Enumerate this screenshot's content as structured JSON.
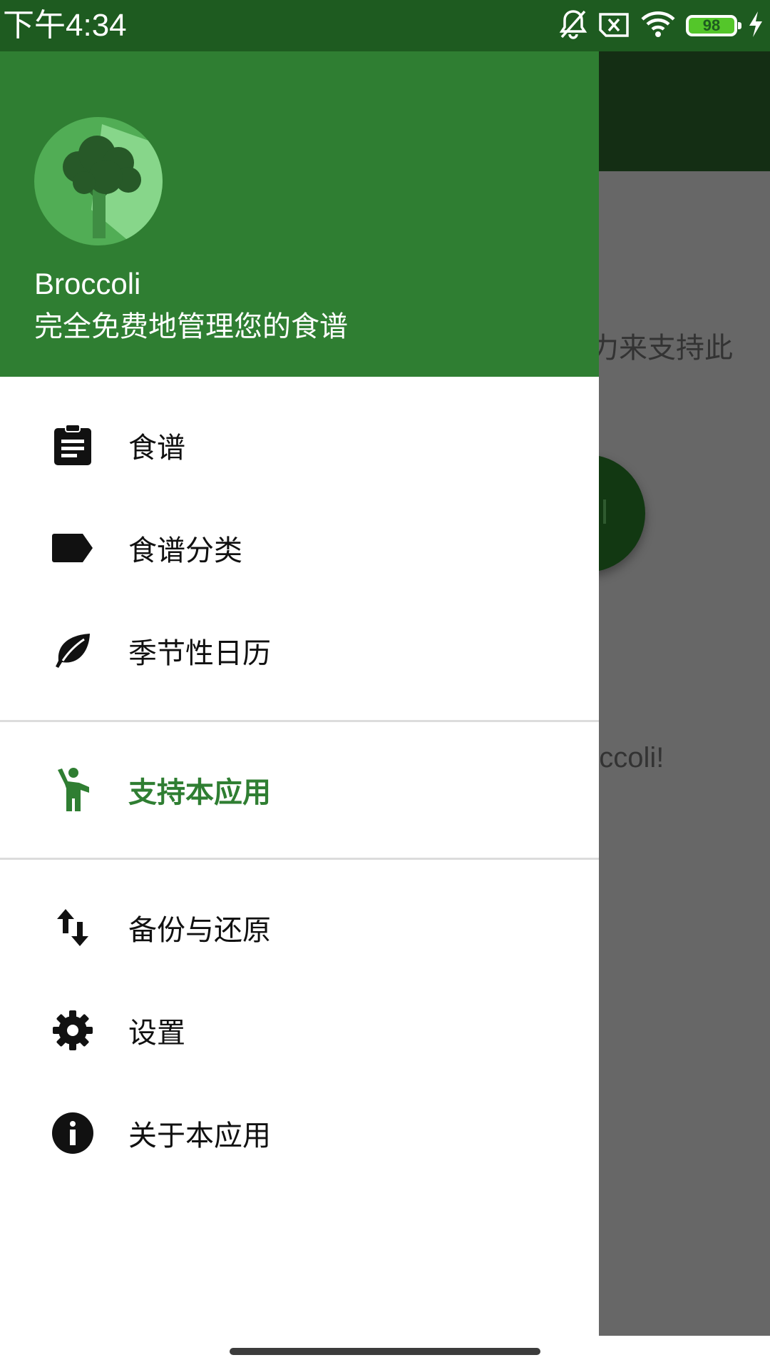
{
  "status_bar": {
    "time": "下午4:34",
    "battery_level": "98",
    "icons": [
      "bell-off-icon",
      "sim-x-icon",
      "wifi-icon",
      "battery-icon",
      "charging-icon"
    ]
  },
  "background": {
    "text_line_1": "力来支持此",
    "text_line_2": "occoli!"
  },
  "drawer": {
    "header": {
      "app_name": "Broccoli",
      "tagline": "完全免费地管理您的食谱"
    },
    "items": [
      {
        "label": "食谱",
        "icon": "clipboard-icon"
      },
      {
        "label": "食谱分类",
        "icon": "label-tag-icon"
      },
      {
        "label": "季节性日历",
        "icon": "leaf-icon"
      },
      {
        "label": "支持本应用",
        "icon": "person-waving-icon",
        "active": true
      },
      {
        "label": "备份与还原",
        "icon": "swap-vertical-icon"
      },
      {
        "label": "设置",
        "icon": "gear-icon"
      },
      {
        "label": "关于本应用",
        "icon": "info-icon"
      }
    ]
  },
  "colors": {
    "status_bar": "#1e5b20",
    "drawer_header": "#2f7e32",
    "accent": "#2f7e32",
    "scrim": "#676767"
  }
}
